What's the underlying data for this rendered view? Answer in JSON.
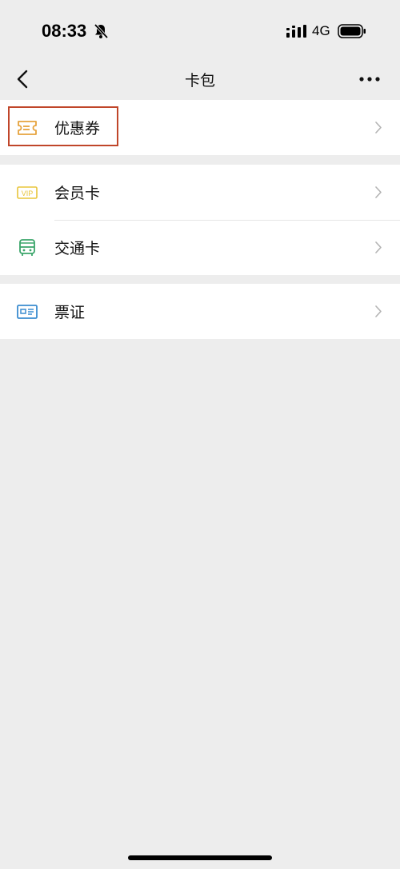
{
  "status_bar": {
    "time": "08:33",
    "network": "4G",
    "mute_icon": "bell-slash-icon",
    "signal_icon": "cellular-signal-icon",
    "battery_icon": "battery-icon"
  },
  "nav": {
    "title": "卡包",
    "back_icon": "chevron-left-icon",
    "more_icon": "ellipsis-icon"
  },
  "groups": [
    {
      "items": [
        {
          "label": "优惠券",
          "icon": "coupon-icon",
          "icon_color": "#e6a23c",
          "highlighted": true
        }
      ]
    },
    {
      "items": [
        {
          "label": "会员卡",
          "icon": "vip-card-icon",
          "icon_color": "#e8c53a"
        },
        {
          "label": "交通卡",
          "icon": "bus-icon",
          "icon_color": "#3aa56a"
        }
      ]
    },
    {
      "items": [
        {
          "label": "票证",
          "icon": "id-card-icon",
          "icon_color": "#3a8ccf"
        }
      ]
    }
  ],
  "colors": {
    "background": "#ededed",
    "card": "#ffffff",
    "highlight_border": "#c0462a",
    "chevron": "#b3b3b3"
  }
}
